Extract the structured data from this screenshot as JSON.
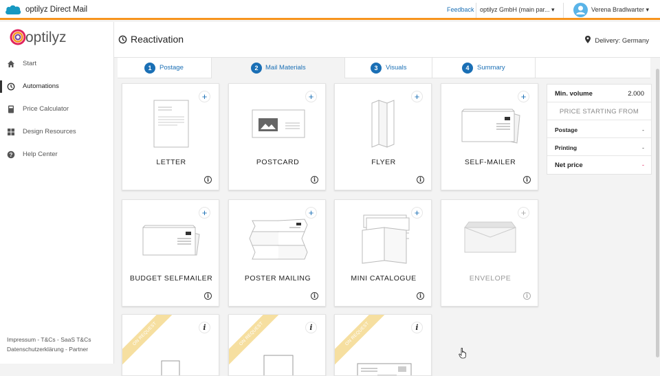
{
  "topbar": {
    "app_title": "optilyz Direct Mail",
    "feedback": "Feedback",
    "company": "optilyz GmbH (main par...",
    "user_name": "Verena Bradlwarter"
  },
  "sidebar": {
    "logo_text": "optilyz",
    "items": [
      {
        "label": "Start",
        "icon": "home-icon"
      },
      {
        "label": "Automations",
        "icon": "clock-icon"
      },
      {
        "label": "Price Calculator",
        "icon": "calculator-icon"
      },
      {
        "label": "Design Resources",
        "icon": "grid-icon"
      },
      {
        "label": "Help Center",
        "icon": "help-icon"
      }
    ],
    "footer_line1": "Impressum - T&Cs - SaaS T&Cs",
    "footer_line2": "Datenschutzerklärung - Partner"
  },
  "header": {
    "title": "Reactivation",
    "delivery_label": "Delivery:",
    "delivery_value": "Germany"
  },
  "tabs": [
    {
      "num": "1",
      "label": "Postage"
    },
    {
      "num": "2",
      "label": "Mail Materials"
    },
    {
      "num": "3",
      "label": "Visuals"
    },
    {
      "num": "4",
      "label": "Summary"
    }
  ],
  "cards": [
    {
      "name": "LETTER"
    },
    {
      "name": "POSTCARD"
    },
    {
      "name": "FLYER"
    },
    {
      "name": "SELF-MAILER"
    },
    {
      "name": "BUDGET SELFMAILER"
    },
    {
      "name": "POSTER MAILING"
    },
    {
      "name": "MINI CATALOGUE"
    },
    {
      "name": "ENVELOPE"
    }
  ],
  "on_request_label": "ON REQUEST",
  "price_box": {
    "min_volume_label": "Min. volume",
    "min_volume_value": "2.000",
    "starting_from": "PRICE STARTING FROM",
    "postage_label": "Postage",
    "postage_value": "-",
    "printing_label": "Printing",
    "printing_value": "-",
    "net_price_label": "Net price",
    "net_price_value": "-"
  },
  "colors": {
    "accent": "#1a6fb5",
    "topbar_border": "#f7941d",
    "net_price_value": "#e0245e"
  }
}
